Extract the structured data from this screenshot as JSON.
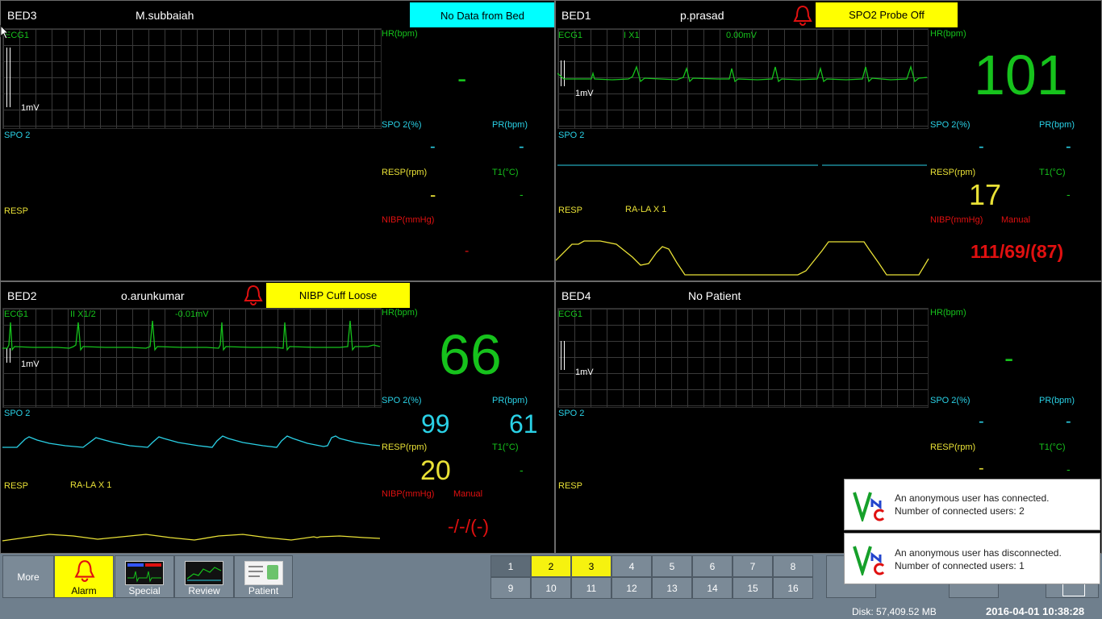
{
  "beds": {
    "bed3": {
      "bed": "BED3",
      "patient": "M.subbaiah",
      "alarm": "No Data from Bed",
      "ecg_label": "ECG1",
      "mv": "1mV",
      "spo2_label": "SPO 2",
      "resp_label": "RESP",
      "hr_label": "HR(bpm)",
      "hr": "-",
      "spo2p_label": "SPO 2(%)",
      "spo2": "-",
      "pr_label": "PR(bpm)",
      "pr": "-",
      "respr_label": "RESP(rpm)",
      "resp": "-",
      "t1_label": "T1(°C)",
      "t1": "-",
      "nibp_label": "NIBP(mmHg)",
      "nibp": "-"
    },
    "bed1": {
      "bed": "BED1",
      "patient": "p.prasad",
      "alarm": "SPO2 Probe Off",
      "ecg_label": "ECG1",
      "ecg_lead": "I  X1",
      "ecg_mv": "0.00mV",
      "mv": "1mV",
      "spo2_label": "SPO 2",
      "resp_label": "RESP",
      "resp_lead": "RA-LA  X 1",
      "hr_label": "HR(bpm)",
      "hr": "101",
      "spo2p_label": "SPO 2(%)",
      "spo2": "-",
      "pr_label": "PR(bpm)",
      "pr": "-",
      "respr_label": "RESP(rpm)",
      "resp": "17",
      "t1_label": "T1(°C)",
      "t1": "-",
      "nibp_label": "NIBP(mmHg)",
      "nibp_mode": "Manual",
      "nibp": "111/69/(87)"
    },
    "bed2": {
      "bed": "BED2",
      "patient": "o.arunkumar",
      "alarm": "NIBP Cuff Loose",
      "ecg_label": "ECG1",
      "ecg_lead": "II  X1/2",
      "ecg_mv": "-0.01mV",
      "mv": "1mV",
      "spo2_label": "SPO 2",
      "resp_label": "RESP",
      "resp_lead": "RA-LA  X 1",
      "hr_label": "HR(bpm)",
      "hr": "66",
      "spo2p_label": "SPO 2(%)",
      "spo2": "99",
      "pr_label": "PR(bpm)",
      "pr": "61",
      "respr_label": "RESP(rpm)",
      "resp": "20",
      "t1_label": "T1(°C)",
      "t1": "-",
      "nibp_label": "NIBP(mmHg)",
      "nibp_mode": "Manual",
      "nibp": "-/-/(-)"
    },
    "bed4": {
      "bed": "BED4",
      "patient": "No Patient",
      "ecg_label": "ECG1",
      "mv": "1mV",
      "spo2_label": "SPO 2",
      "resp_label": "RESP",
      "hr_label": "HR(bpm)",
      "hr": "-",
      "spo2p_label": "SPO 2(%)",
      "spo2": "-",
      "pr_label": "PR(bpm)",
      "pr": "-",
      "respr_label": "RESP(rpm)",
      "resp": "-",
      "t1_label": "T1(°C)",
      "t1": "-"
    }
  },
  "toolbar": {
    "more": "More",
    "alarm": "Alarm",
    "special": "Special",
    "review": "Review",
    "patient": "Patient",
    "bed_numbers": [
      "1",
      "2",
      "3",
      "4",
      "5",
      "6",
      "7",
      "8",
      "9",
      "10",
      "11",
      "12",
      "13",
      "14",
      "15",
      "16"
    ],
    "highlighted_beds": [
      "2",
      "3"
    ]
  },
  "status": {
    "disk": "Disk: 57,409.52 MB",
    "datetime": "2016-04-01  10:38:28"
  },
  "notifications": [
    {
      "line1": "An anonymous user has connected.",
      "line2": "Number of connected users: 2"
    },
    {
      "line1": "An anonymous user has disconnected.",
      "line2": "Number of connected users: 1"
    }
  ],
  "colors": {
    "ecg": "#16c21c",
    "spo2": "#2ad1e6",
    "resp": "#e9e136",
    "nibp": "#e01010",
    "alarm_cyan": "#00ffff",
    "alarm_yellow": "#ffff00"
  }
}
